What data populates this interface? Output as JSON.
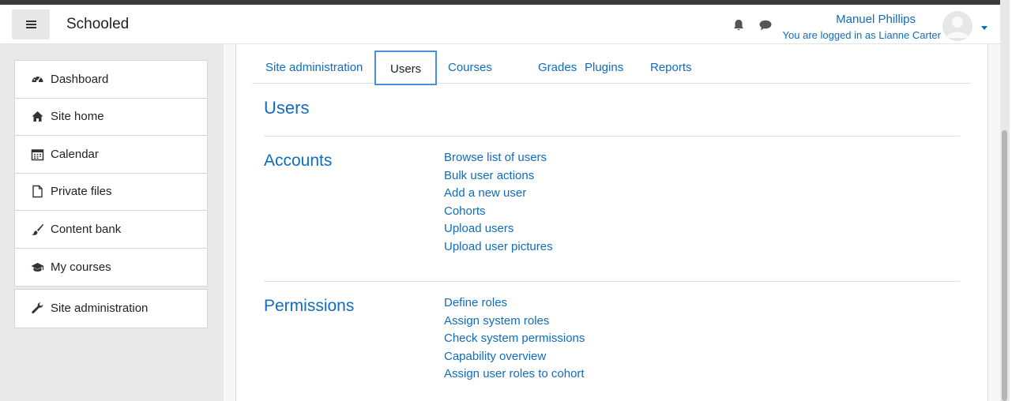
{
  "navbar": {
    "brand": "Schooled",
    "user_name": "Manuel Phillips",
    "logged_in_as": "You are logged in as Lianne Carter",
    "icons": [
      "menu-icon",
      "bell-icon",
      "chat-icon",
      "avatar",
      "chevron-down-icon"
    ]
  },
  "drawer": {
    "items": [
      {
        "label": "Dashboard",
        "icon": "dashboard-icon"
      },
      {
        "label": "Site home",
        "icon": "home-icon"
      },
      {
        "label": "Calendar",
        "icon": "calendar-icon"
      },
      {
        "label": "Private files",
        "icon": "file-icon"
      },
      {
        "label": "Content bank",
        "icon": "brush-icon"
      },
      {
        "label": "My courses",
        "icon": "graduation-cap-icon"
      }
    ],
    "admin_item": {
      "label": "Site administration",
      "icon": "wrench-icon"
    }
  },
  "tabs": [
    {
      "label": "Site administration",
      "active": false
    },
    {
      "label": "Users",
      "active": true
    },
    {
      "label": "Courses",
      "active": false
    },
    {
      "label": "Grades",
      "active": false
    },
    {
      "label": "Plugins",
      "active": false
    },
    {
      "label": "Reports",
      "active": false
    }
  ],
  "main": {
    "heading": "Users",
    "sections": [
      {
        "title": "Accounts",
        "links": [
          "Browse list of users",
          "Bulk user actions",
          "Add a new user",
          "Cohorts",
          "Upload users",
          "Upload user pictures"
        ]
      },
      {
        "title": "Permissions",
        "links": [
          "Define roles",
          "Assign system roles",
          "Check system permissions",
          "Capability overview",
          "Assign user roles to cohort"
        ]
      }
    ]
  },
  "colors": {
    "link": "#0f6cbf",
    "active_tab_border": "#4a90d9",
    "drawer_bg": "#e9e9e9"
  }
}
